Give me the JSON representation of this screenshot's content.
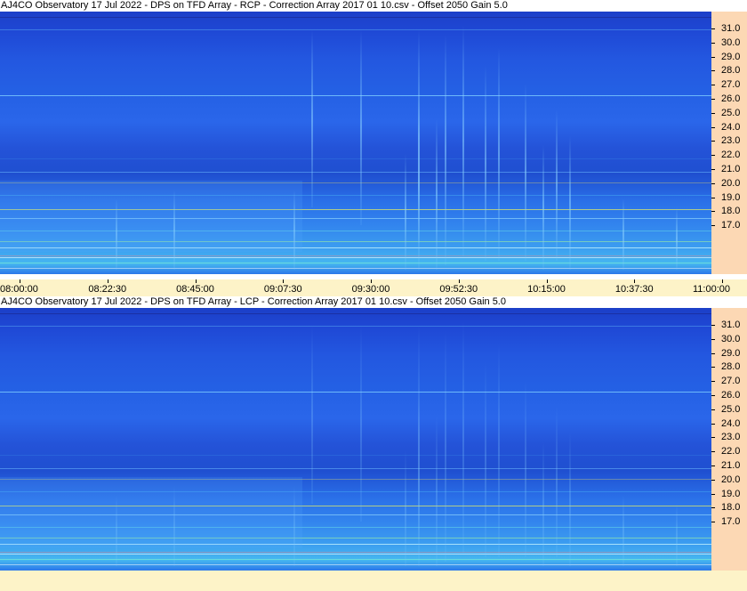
{
  "panels": [
    {
      "title": "AJ4CO Observatory 17 Jul 2022  -  DPS on TFD Array  -  RCP  -  Correction Array 2017 01 10.csv  -  Offset 2050  Gain 5.0",
      "polarization": "RCP"
    },
    {
      "title": "AJ4CO Observatory 17 Jul 2022  -  DPS on TFD Array  -  LCP  -  Correction Array 2017 01 10.csv  -  Offset 2050  Gain 5.0",
      "polarization": "LCP"
    }
  ],
  "freq_labels": [
    "31.0",
    "30.0",
    "29.0",
    "28.0",
    "27.0",
    "26.0",
    "25.0",
    "24.0",
    "23.0",
    "22.0",
    "21.0",
    "20.0",
    "19.0",
    "18.0",
    "17.0"
  ],
  "time_labels": [
    "08:00:00",
    "08:22:30",
    "08:45:00",
    "09:07:30",
    "09:30:00",
    "09:52:30",
    "10:15:00",
    "10:37:30",
    "11:00:00"
  ],
  "colors": {
    "freq_axis_bg": "#fcd8b4",
    "time_axis_bg": "#fdf3c8",
    "spectrogram_low": "#1c3fc8",
    "spectrogram_high": "#46b7f0"
  }
}
